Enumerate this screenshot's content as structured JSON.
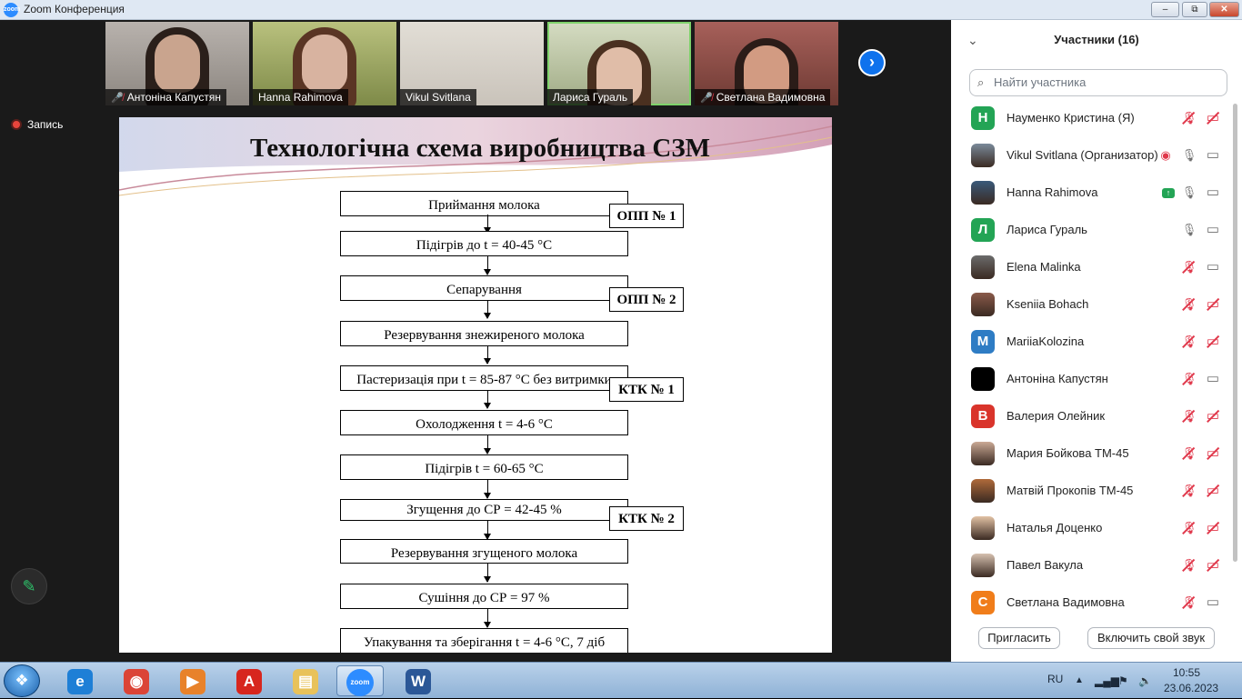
{
  "window": {
    "title": "Zoom Конференция",
    "logo_text": "zoom",
    "minimize": "–",
    "restore": "⧉",
    "close": "✕"
  },
  "video_strip": {
    "thumbnails": [
      {
        "name": "Антоніна Капустян",
        "muted": true
      },
      {
        "name": "Hanna Rahimova",
        "muted": false
      },
      {
        "name": "Vikul Svitlana",
        "muted": false
      },
      {
        "name": "Лариса Гураль",
        "muted": false
      },
      {
        "name": "Светлана Вадимовна",
        "muted": true
      }
    ],
    "next_icon": "›"
  },
  "recording": {
    "label": "Запись"
  },
  "annotate_icon": "✎",
  "slide": {
    "title": "Технологічна схема виробництва СЗМ",
    "steps": [
      "Приймання молока",
      "Підігрів до t = 40-45 °С",
      "Сепарування",
      "Резервування знежиреного молока",
      "Пастеризація при t = 85-87 °С без витримки",
      "Охолодження t = 4-6 °С",
      "Підігрів t = 60-65 °С",
      "Згущення до СР = 42-45 %",
      "Резервування згущеного молока",
      "Сушіння до СР = 97 %",
      "Упакування та зберігання t = 4-6 °С, 7 діб"
    ],
    "tags": [
      "ОПП № 1",
      "ОПП № 2",
      "КТК № 1",
      "КТК № 2"
    ]
  },
  "participants_panel": {
    "title": "Участники (16)",
    "collapse_icon": "⌄",
    "search_placeholder": "Найти участника",
    "search_icon": "🔍",
    "participants": [
      {
        "initial": "Н",
        "name": "Науменко Кристина (Я)",
        "avatar_color": "#23a455",
        "photo": false,
        "mic_muted": true,
        "cam_off": true
      },
      {
        "initial": "",
        "name": "Vikul Svitlana (Организатор)",
        "avatar_color": "#7a8a9a",
        "photo": true,
        "mic_muted": false,
        "cam_off": false,
        "recording": true
      },
      {
        "initial": "",
        "name": "Hanna Rahimova",
        "avatar_color": "#3a5a7a",
        "photo": true,
        "mic_muted": false,
        "cam_off": false,
        "sharing": true
      },
      {
        "initial": "Л",
        "name": "Лариса Гураль",
        "avatar_color": "#23a455",
        "photo": false,
        "mic_muted": false,
        "cam_off": false
      },
      {
        "initial": "",
        "name": "Elena Malinka",
        "avatar_color": "#6b6b6b",
        "photo": true,
        "mic_muted": true,
        "cam_off": false
      },
      {
        "initial": "",
        "name": "Kseniia Bohach",
        "avatar_color": "#8a5a4a",
        "photo": true,
        "mic_muted": true,
        "cam_off": true
      },
      {
        "initial": "M",
        "name": "MariiaKolozina",
        "avatar_color": "#2e7cc4",
        "photo": false,
        "mic_muted": true,
        "cam_off": true
      },
      {
        "initial": "",
        "name": "Антоніна Капустян",
        "avatar_color": "#000000",
        "photo": false,
        "mic_muted": true,
        "cam_off": false
      },
      {
        "initial": "В",
        "name": "Валерия Олейник",
        "avatar_color": "#d9342b",
        "photo": false,
        "mic_muted": true,
        "cam_off": true
      },
      {
        "initial": "",
        "name": "Мария Бойкова ТМ-45",
        "avatar_color": "#caa995",
        "photo": true,
        "mic_muted": true,
        "cam_off": true
      },
      {
        "initial": "",
        "name": "Матвій Прокопів ТМ-45",
        "avatar_color": "#b06a3a",
        "photo": true,
        "mic_muted": true,
        "cam_off": true
      },
      {
        "initial": "",
        "name": "Наталья Доценко",
        "avatar_color": "#e2c2a5",
        "photo": true,
        "mic_muted": true,
        "cam_off": true
      },
      {
        "initial": "",
        "name": "Павел Вакула",
        "avatar_color": "#d6c1b0",
        "photo": true,
        "mic_muted": true,
        "cam_off": true
      },
      {
        "initial": "С",
        "name": "Светлана Вадимовна",
        "avatar_color": "#f07d1a",
        "photo": false,
        "mic_muted": true,
        "cam_off": false
      }
    ],
    "invite_label": "Пригласить",
    "unmute_label": "Включить свой звук"
  },
  "taskbar": {
    "start_icon": "❖",
    "apps": [
      {
        "name": "internet-explorer-icon",
        "glyph": "e",
        "color": "#1e7fd6"
      },
      {
        "name": "chrome-icon",
        "glyph": "◉",
        "color": "#db4437"
      },
      {
        "name": "media-player-icon",
        "glyph": "▶",
        "color": "#e8822a"
      },
      {
        "name": "acrobat-icon",
        "glyph": "A",
        "color": "#d7261e"
      },
      {
        "name": "explorer-folder-icon",
        "glyph": "▤",
        "color": "#e8c25a"
      },
      {
        "name": "zoom-icon",
        "glyph": "zoom",
        "color": "#2d8cff",
        "active": true
      },
      {
        "name": "word-icon",
        "glyph": "W",
        "color": "#2b5797"
      }
    ],
    "language": "RU",
    "time": "10:55",
    "date": "23.06.2023"
  }
}
